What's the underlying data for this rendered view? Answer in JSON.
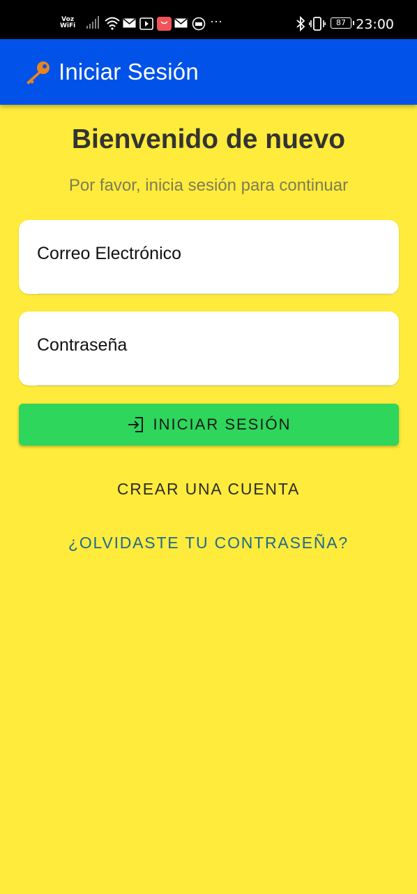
{
  "status_bar": {
    "carrier_line1": "Voz",
    "carrier_line2": "WiFi",
    "battery": "87",
    "time": "23:00",
    "icons": [
      "signal-icon",
      "wifi-icon",
      "mail-icon",
      "video-icon",
      "shop-app-icon",
      "mail-icon",
      "message-icon",
      "more-icon",
      "bluetooth-icon",
      "vibrate-icon"
    ]
  },
  "app_bar": {
    "icon": "key-icon",
    "title": "Iniciar Sesión",
    "color": "#0052E8"
  },
  "main": {
    "heading": "Bienvenido de nuevo",
    "subheading": "Por favor, inicia sesión para continuar",
    "email_placeholder": "Correo Electrónico",
    "password_placeholder": "Contraseña",
    "login_icon": "login-icon",
    "login_label": "INICIAR SESIÓN",
    "create_account_label": "CREAR UNA CUENTA",
    "forgot_password_label": "¿OLVIDASTE TU CONTRASEÑA?"
  },
  "colors": {
    "background": "#FFEB3B",
    "primary_button": "#2ED65C",
    "link": "#1e6a8f"
  }
}
